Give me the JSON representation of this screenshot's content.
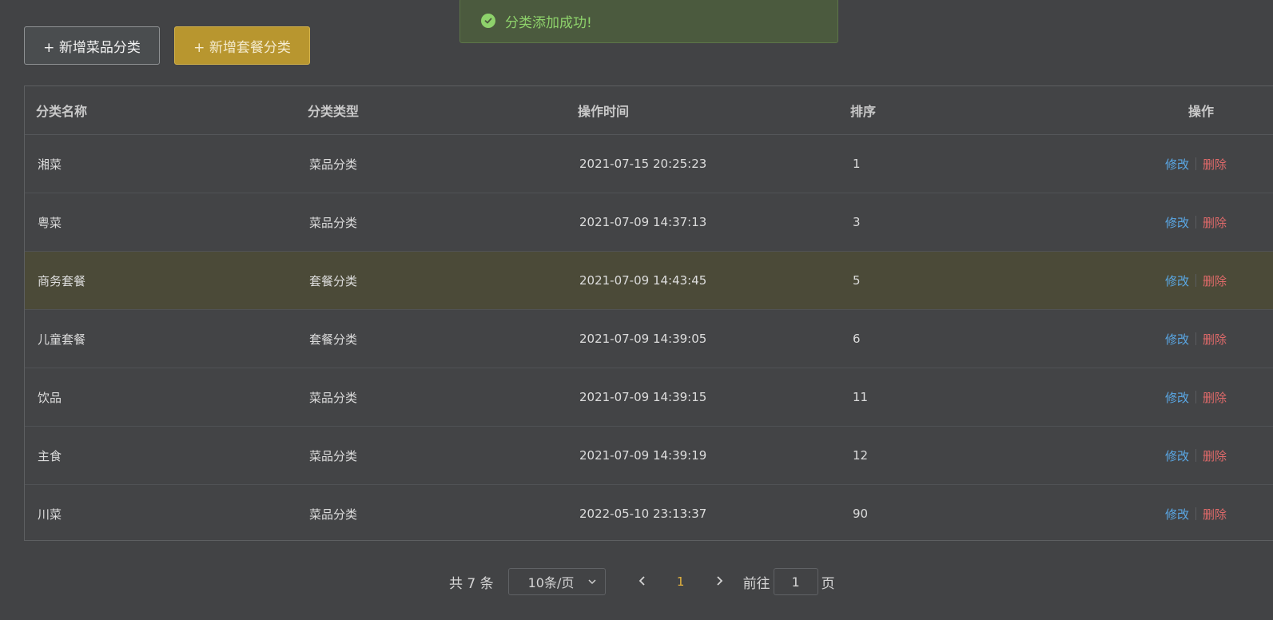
{
  "toolbar": {
    "add_dish_label": "+ 新增菜品分类",
    "add_combo_label": "+ 新增套餐分类"
  },
  "toast": {
    "message": "分类添加成功!"
  },
  "table": {
    "headers": {
      "name": "分类名称",
      "type": "分类类型",
      "time": "操作时间",
      "sort": "排序",
      "ops": "操作"
    },
    "rows": [
      {
        "name": "湘菜",
        "type": "菜品分类",
        "time": "2021-07-15 20:25:23",
        "sort": "1",
        "edit": "修改",
        "del": "删除"
      },
      {
        "name": "粤菜",
        "type": "菜品分类",
        "time": "2021-07-09 14:37:13",
        "sort": "3",
        "edit": "修改",
        "del": "删除"
      },
      {
        "name": "商务套餐",
        "type": "套餐分类",
        "time": "2021-07-09 14:43:45",
        "sort": "5",
        "edit": "修改",
        "del": "删除"
      },
      {
        "name": "儿童套餐",
        "type": "套餐分类",
        "time": "2021-07-09 14:39:05",
        "sort": "6",
        "edit": "修改",
        "del": "删除"
      },
      {
        "name": "饮品",
        "type": "菜品分类",
        "time": "2021-07-09 14:39:15",
        "sort": "11",
        "edit": "修改",
        "del": "删除"
      },
      {
        "name": "主食",
        "type": "菜品分类",
        "time": "2021-07-09 14:39:19",
        "sort": "12",
        "edit": "修改",
        "del": "删除"
      },
      {
        "name": "川菜",
        "type": "菜品分类",
        "time": "2022-05-10 23:13:37",
        "sort": "90",
        "edit": "修改",
        "del": "删除"
      }
    ]
  },
  "pagination": {
    "total_text": "共 7 条",
    "page_size": "10条/页",
    "current_page": "1",
    "goto_label": "前往",
    "goto_value": "1",
    "page_suffix": "页"
  },
  "colors": {
    "background": "#424345",
    "accent": "#b8962f",
    "success": "#8ed26b",
    "edit_link": "#5aa8e6",
    "delete_link": "#e06a6a",
    "current_page": "#e2b23e"
  }
}
